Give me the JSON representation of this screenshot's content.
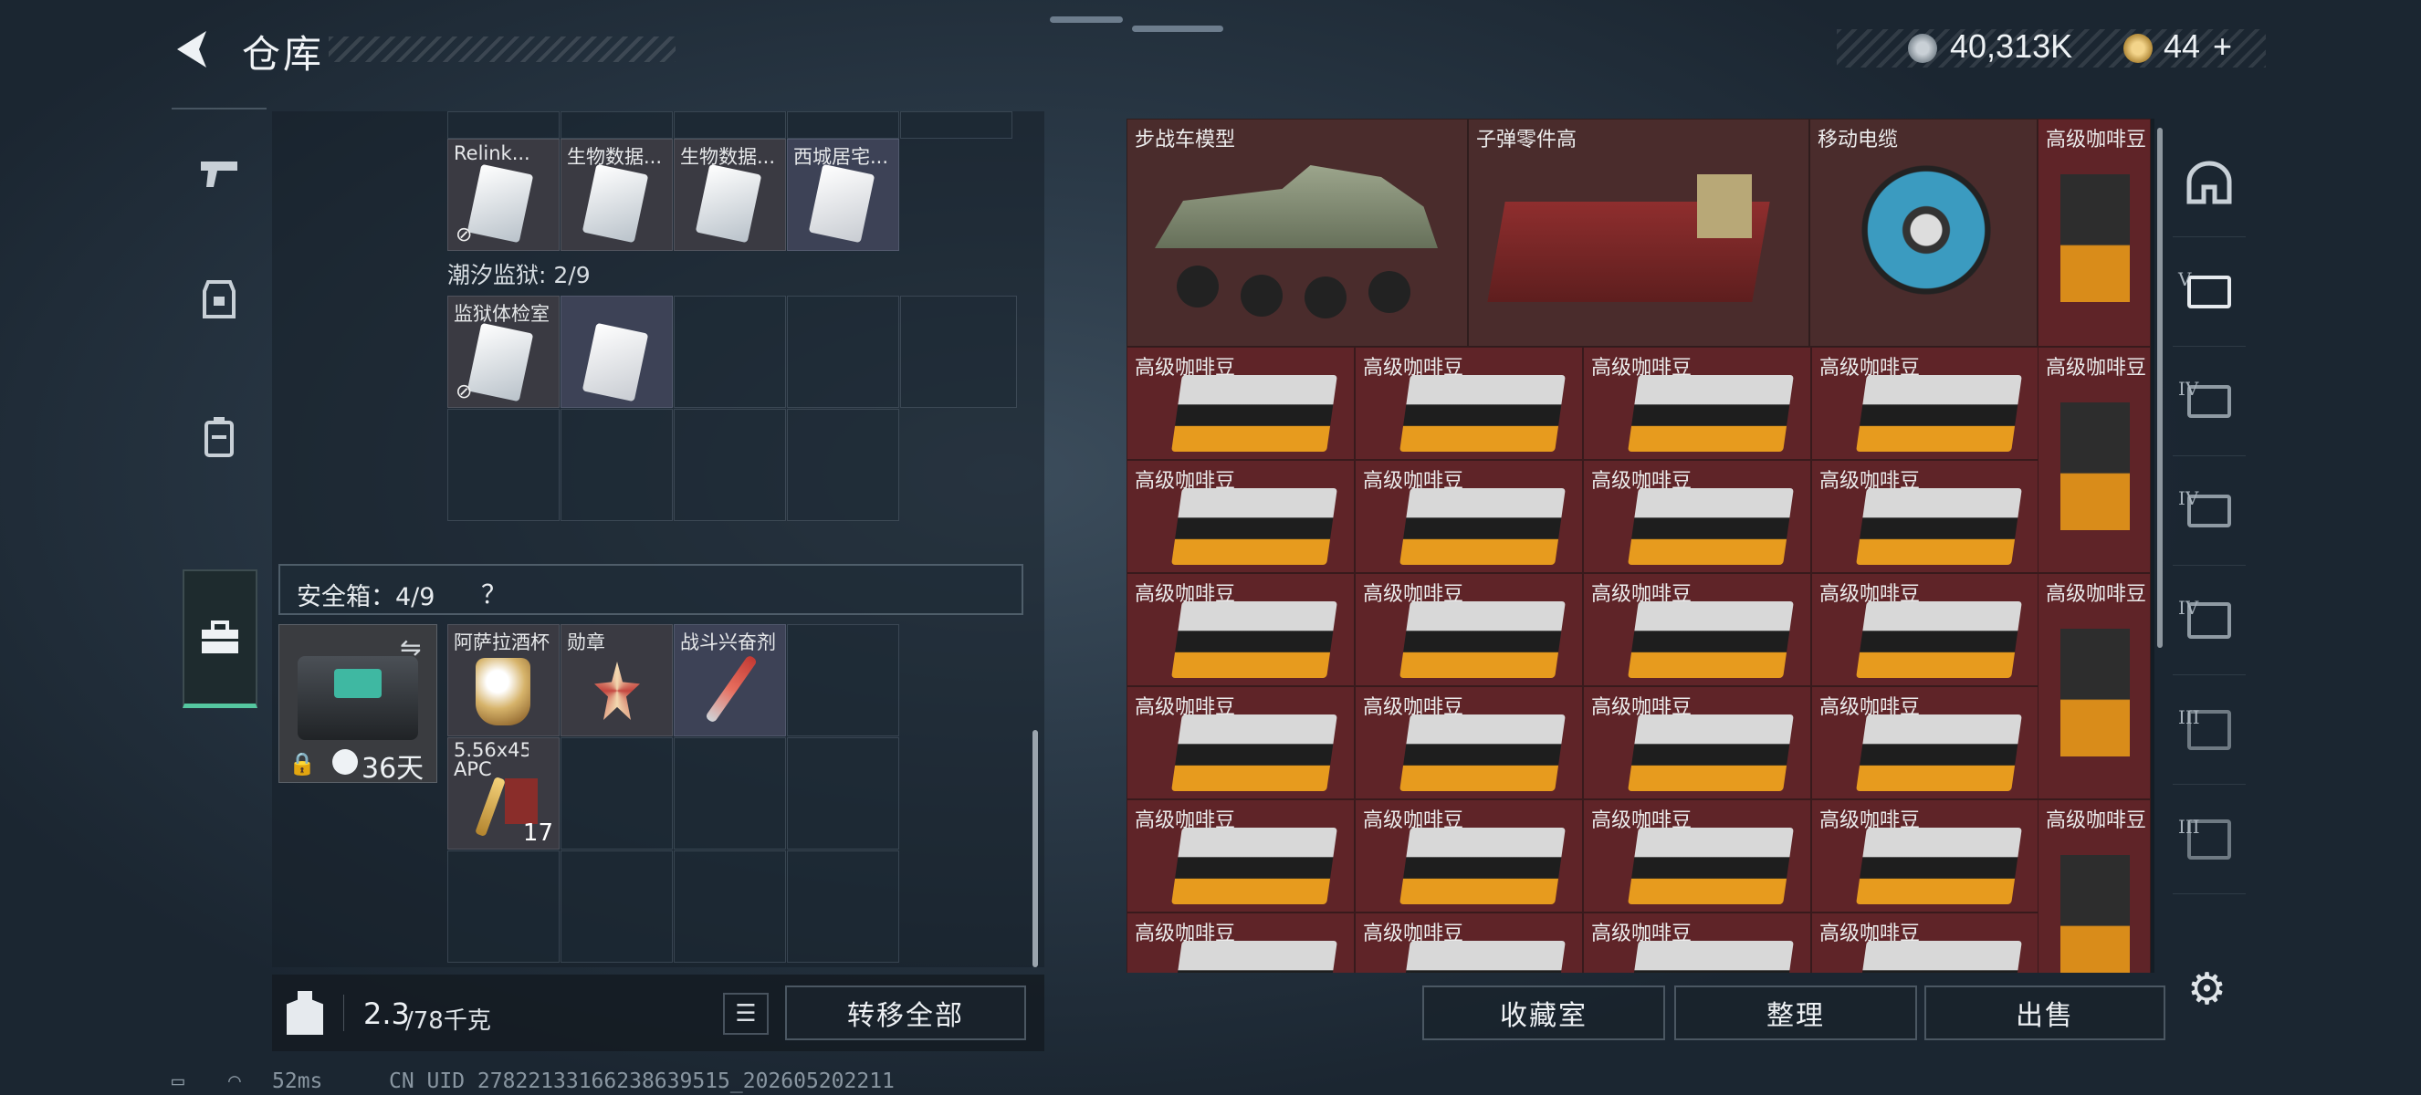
{
  "header": {
    "title": "仓库",
    "back_icon": "back-arrow-icon"
  },
  "currency": {
    "silver": "40,313K",
    "gold": "44",
    "add": "+"
  },
  "tabs": [
    {
      "name": "weapon"
    },
    {
      "name": "armor"
    },
    {
      "name": "backpack"
    },
    {
      "name": "case",
      "active": true
    }
  ],
  "left": {
    "row_top": [
      {
        "label": "Relink...",
        "item": "card-silver",
        "locked": true
      },
      {
        "label": "生物数据...",
        "item": "card-silver"
      },
      {
        "label": "生物数据...",
        "item": "card-silver"
      },
      {
        "label": "西城居宅...",
        "item": "card-white",
        "blue": true
      }
    ],
    "section2_title": "潮汐监狱: 2/9",
    "section2_items": [
      {
        "label": "监狱体检室（仿制）食...",
        "item": "card-silver",
        "locked": true
      },
      {
        "label": "",
        "item": "card-white",
        "blue": true
      }
    ],
    "safe": {
      "title": "安全箱：4/9",
      "help": "？",
      "days": "36天"
    },
    "safe_items": [
      {
        "label": "阿萨拉酒杯",
        "item": "cup"
      },
      {
        "label": "勋章",
        "item": "medal"
      },
      {
        "label": "战斗兴奋剂",
        "item": "stim"
      },
      {
        "label": "5.56x45 APC",
        "item": "ammo",
        "count": "17"
      }
    ],
    "weight": "2.3",
    "weight_max": "/78千克",
    "transfer_all": "转移全部"
  },
  "right": {
    "top": [
      {
        "label": "步战车模型",
        "item": "tank"
      },
      {
        "label": "子弹零件高",
        "item": "parts"
      },
      {
        "label": "移动电缆",
        "item": "cable"
      },
      {
        "label": "高级咖啡豆",
        "item": "coffee-bag"
      }
    ],
    "coffee_label": "高级咖啡豆",
    "buttons": {
      "collection": "收藏室",
      "sort": "整理",
      "sell": "出售"
    }
  },
  "sidebar_right": [
    {
      "name": "helmet-slot"
    },
    {
      "name": "tier-v-case",
      "num": "V"
    },
    {
      "name": "tier-iv-case",
      "num": "IV"
    },
    {
      "name": "tier-iv-medkit",
      "num": "IV"
    },
    {
      "name": "tier-iv-folder",
      "num": "IV"
    },
    {
      "name": "tier-iii-case",
      "num": "III"
    },
    {
      "name": "tier-iii-case-2",
      "num": "III"
    }
  ],
  "status": {
    "ping": "52ms",
    "uid": "CN UID 27822133166238639515_202605202211"
  },
  "colors": {
    "accent": "#55c7a0",
    "item_red": "#5f2428",
    "item_blue": "#3d4256"
  }
}
